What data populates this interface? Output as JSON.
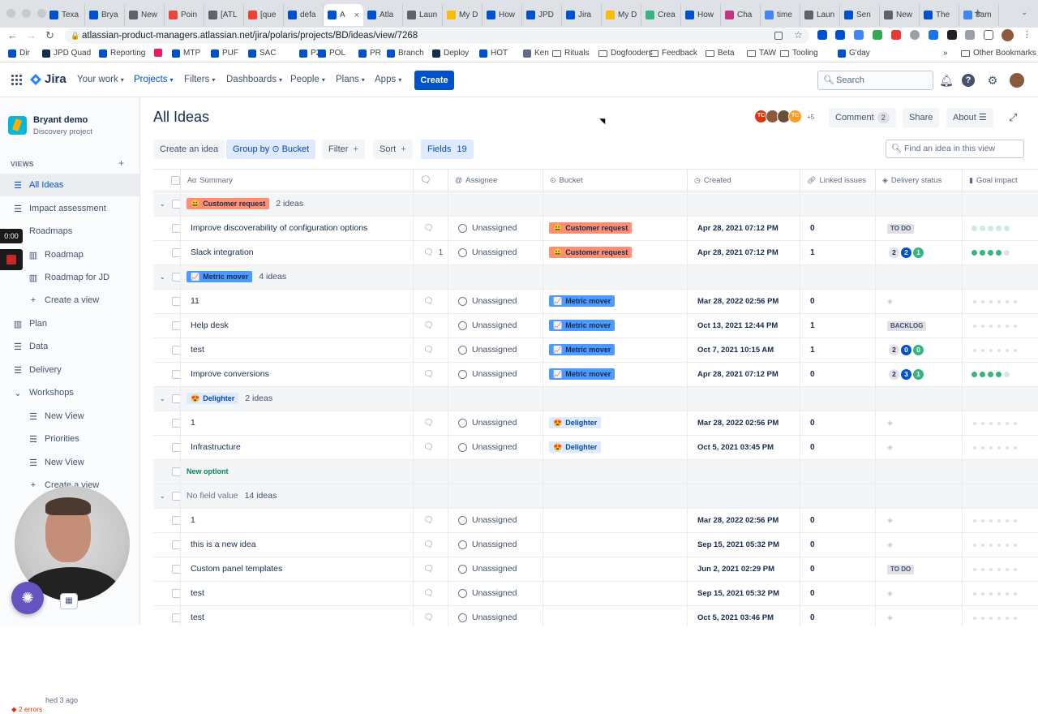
{
  "browser": {
    "tabs": [
      {
        "label": "Texa",
        "color": "#0052cc"
      },
      {
        "label": "Brya",
        "color": "#0052cc"
      },
      {
        "label": "New",
        "color": "#5f6368"
      },
      {
        "label": "Poin",
        "color": "#e8453c"
      },
      {
        "label": "[ATL",
        "color": "#5f6368"
      },
      {
        "label": "[que",
        "color": "#ea4335"
      },
      {
        "label": "defa",
        "color": "#0052cc"
      },
      {
        "label": "A",
        "color": "#0052cc",
        "active": true
      },
      {
        "label": "Atla",
        "color": "#0052cc"
      },
      {
        "label": "Laun",
        "color": "#5f6368"
      },
      {
        "label": "My D",
        "color": "#fbbc04"
      },
      {
        "label": "How",
        "color": "#0052cc"
      },
      {
        "label": "JPD",
        "color": "#0052cc"
      },
      {
        "label": "Jira",
        "color": "#0052cc"
      },
      {
        "label": "My D",
        "color": "#fbbc04"
      },
      {
        "label": "Crea",
        "color": "#36b37e"
      },
      {
        "label": "How",
        "color": "#0052cc"
      },
      {
        "label": "Cha",
        "color": "#c13584"
      },
      {
        "label": "time",
        "color": "#4285f4"
      },
      {
        "label": "Laun",
        "color": "#5f6368"
      },
      {
        "label": "Sen",
        "color": "#0052cc"
      },
      {
        "label": "New",
        "color": "#5f6368"
      },
      {
        "label": "The",
        "color": "#0052cc"
      },
      {
        "label": "8am",
        "color": "#4285f4"
      }
    ],
    "url": "atlassian-product-managers.atlassian.net/jira/polaris/projects/BD/ideas/view/7268",
    "bookmarks": [
      {
        "label": "Dir",
        "icon": "#0052cc"
      },
      {
        "label": "JPD Quad",
        "icon": "#172b4d"
      },
      {
        "label": "Reporting",
        "icon": "#0052cc"
      },
      {
        "label": "",
        "icon": "#e91e63"
      },
      {
        "label": "MTP",
        "icon": "#0052cc"
      },
      {
        "label": "PUF",
        "icon": "#0052cc"
      },
      {
        "label": "SAC",
        "icon": "#0052cc"
      },
      {
        "label": "P2",
        "icon": "#0052cc"
      },
      {
        "label": "POL",
        "icon": "#0052cc"
      },
      {
        "label": "PR",
        "icon": "#0052cc"
      },
      {
        "label": "Branch",
        "icon": "#0052cc"
      },
      {
        "label": "Deploy",
        "icon": "#172b4d"
      },
      {
        "label": "HOT",
        "icon": "#0052cc"
      },
      {
        "label": "Ken",
        "icon": "#5e6c84"
      },
      {
        "label": "Rituals",
        "icon": "folder"
      },
      {
        "label": "Dogfooders",
        "icon": "folder"
      },
      {
        "label": "Feedback",
        "icon": "folder"
      },
      {
        "label": "Beta",
        "icon": "folder"
      },
      {
        "label": "TAW",
        "icon": "folder"
      },
      {
        "label": "Tooling",
        "icon": "folder"
      },
      {
        "label": "G'day",
        "icon": "#0052cc"
      }
    ],
    "more": "»",
    "other_bookmarks": "Other Bookmarks"
  },
  "jira": {
    "logo": "Jira",
    "nav": [
      "Your work",
      "Projects",
      "Filters",
      "Dashboards",
      "People",
      "Plans",
      "Apps"
    ],
    "create": "Create",
    "search_placeholder": "Search"
  },
  "sidebar": {
    "project_name": "Bryant demo",
    "project_type": "Discovery project",
    "views_heading": "VIEWS",
    "items": [
      {
        "label": "All Ideas",
        "icon": "list",
        "selected": true
      },
      {
        "label": "Impact assessment",
        "icon": "list"
      },
      {
        "label": "Roadmaps",
        "icon": "chevron"
      },
      {
        "label": "Roadmap",
        "icon": "board",
        "indent": true
      },
      {
        "label": "Roadmap for JD",
        "icon": "board",
        "indent": true
      },
      {
        "label": "Create a view",
        "icon": "plus",
        "indent": true
      },
      {
        "label": "Plan",
        "icon": "board"
      },
      {
        "label": "Data",
        "icon": "list"
      },
      {
        "label": "Delivery",
        "icon": "list"
      },
      {
        "label": "Workshops",
        "icon": "chevron-down"
      },
      {
        "label": "New View",
        "icon": "list",
        "indent": true
      },
      {
        "label": "Priorities",
        "icon": "list",
        "indent": true
      },
      {
        "label": "New View",
        "icon": "list",
        "indent": true
      },
      {
        "label": "Create a view",
        "icon": "plus",
        "indent": true
      }
    ],
    "updated": "hed 3 ago",
    "errors": "2 errors"
  },
  "recording": {
    "timer": "0:00"
  },
  "header": {
    "title": "All Ideas",
    "avatars": [
      {
        "initials": "TC",
        "color": "#de350b"
      },
      {
        "initials": "",
        "color": "#8b5a3c"
      },
      {
        "initials": "",
        "color": "#6b4f3a"
      },
      {
        "initials": "TC",
        "color": "#ff991f"
      }
    ],
    "extra_avatars": "+5",
    "comment": "Comment",
    "comment_count": "2",
    "share": "Share",
    "about": "About"
  },
  "toolbar": {
    "create_idea": "Create an idea",
    "group_by": "Group by",
    "group_by_value": "Bucket",
    "filter": "Filter",
    "sort": "Sort",
    "fields": "Fields",
    "fields_count": "19",
    "find_placeholder": "Find an idea in this view"
  },
  "table": {
    "columns": [
      "Summary",
      "",
      "Assignee",
      "Bucket",
      "Created",
      "Linked issues",
      "Delivery status",
      "Goal impact"
    ],
    "rows": [
      {
        "type": "group",
        "tag": "Customer request",
        "tagClass": "tag-cr",
        "emoji": "😃",
        "count": "2 ideas"
      },
      {
        "type": "idea",
        "summary": "Improve discoverability of configuration options",
        "comments": "",
        "assignee": "Unassigned",
        "bucket": "Customer request",
        "bucketClass": "tag-cr",
        "emoji": "😃",
        "created": "Apr 28, 2021 07:12 PM",
        "linked": "0",
        "status": {
          "kind": "label",
          "text": "TO DO"
        },
        "goal": {
          "kind": "partial",
          "filled": 0
        }
      },
      {
        "type": "idea",
        "summary": "Slack integration",
        "comments": "1",
        "assignee": "Unassigned",
        "bucket": "Customer request",
        "bucketClass": "tag-cr",
        "emoji": "😃",
        "created": "Apr 28, 2021 07:12 PM",
        "linked": "1",
        "status": {
          "kind": "pills",
          "values": [
            "2",
            "2",
            "1"
          ]
        },
        "goal": {
          "kind": "full",
          "filled": 4
        }
      },
      {
        "type": "group",
        "tag": "Metric mover",
        "tagClass": "tag-mm",
        "emoji": "📈",
        "count": "4 ideas"
      },
      {
        "type": "idea",
        "summary": "11",
        "comments": "",
        "assignee": "Unassigned",
        "bucket": "Metric mover",
        "bucketClass": "tag-mm",
        "emoji": "📈",
        "created": "Mar 28, 2022 02:56 PM",
        "linked": "0",
        "status": {
          "kind": "empty"
        },
        "goal": {
          "kind": "empty"
        }
      },
      {
        "type": "idea",
        "summary": "Help desk",
        "comments": "",
        "assignee": "Unassigned",
        "bucket": "Metric mover",
        "bucketClass": "tag-mm",
        "emoji": "📈",
        "created": "Oct 13, 2021 12:44 PM",
        "linked": "1",
        "status": {
          "kind": "label",
          "text": "BACKLOG"
        },
        "goal": {
          "kind": "empty"
        }
      },
      {
        "type": "idea",
        "summary": "test",
        "comments": "",
        "assignee": "Unassigned",
        "bucket": "Metric mover",
        "bucketClass": "tag-mm",
        "emoji": "📈",
        "created": "Oct 7, 2021 10:15 AM",
        "linked": "1",
        "status": {
          "kind": "pills",
          "values": [
            "2",
            "0",
            "0"
          ]
        },
        "goal": {
          "kind": "empty"
        }
      },
      {
        "type": "idea",
        "summary": "Improve conversions",
        "comments": "",
        "assignee": "Unassigned",
        "bucket": "Metric mover",
        "bucketClass": "tag-mm",
        "emoji": "📈",
        "created": "Apr 28, 2021 07:12 PM",
        "linked": "0",
        "status": {
          "kind": "pills",
          "values": [
            "2",
            "3",
            "1"
          ]
        },
        "goal": {
          "kind": "full",
          "filled": 4
        }
      },
      {
        "type": "group",
        "tag": "Delighter",
        "tagClass": "tag-de",
        "emoji": "😍",
        "count": "2 ideas"
      },
      {
        "type": "idea",
        "summary": "1",
        "comments": "",
        "assignee": "Unassigned",
        "bucket": "Delighter",
        "bucketClass": "tag-de",
        "emoji": "😍",
        "created": "Mar 28, 2022 02:56 PM",
        "linked": "0",
        "status": {
          "kind": "empty"
        },
        "goal": {
          "kind": "empty"
        }
      },
      {
        "type": "idea",
        "summary": "Infrastructure",
        "comments": "",
        "assignee": "Unassigned",
        "bucket": "Delighter",
        "bucketClass": "tag-de",
        "emoji": "😍",
        "created": "Oct 5, 2021 03:45 PM",
        "linked": "0",
        "status": {
          "kind": "empty"
        },
        "goal": {
          "kind": "empty"
        }
      },
      {
        "type": "group",
        "tag": "New optiont",
        "tagClass": "tag-no",
        "emoji": "",
        "count": "",
        "nochev": true
      },
      {
        "type": "group",
        "tag": "No field value",
        "tagClass": "nfv",
        "emoji": "",
        "count": "14 ideas"
      },
      {
        "type": "idea",
        "summary": "1",
        "comments": "",
        "assignee": "Unassigned",
        "bucket": "",
        "created": "Mar 28, 2022 02:56 PM",
        "linked": "0",
        "status": {
          "kind": "empty"
        },
        "goal": {
          "kind": "empty"
        }
      },
      {
        "type": "idea",
        "summary": "this is a new idea",
        "comments": "",
        "assignee": "Unassigned",
        "bucket": "",
        "created": "Sep 15, 2021 05:32 PM",
        "linked": "0",
        "status": {
          "kind": "empty"
        },
        "goal": {
          "kind": "empty"
        }
      },
      {
        "type": "idea",
        "summary": "Custom panel templates",
        "comments": "",
        "assignee": "Unassigned",
        "bucket": "",
        "created": "Jun 2, 2021 02:29 PM",
        "linked": "0",
        "status": {
          "kind": "label",
          "text": "TO DO"
        },
        "goal": {
          "kind": "empty"
        }
      },
      {
        "type": "idea",
        "summary": "test",
        "comments": "",
        "assignee": "Unassigned",
        "bucket": "",
        "created": "Sep 15, 2021 05:32 PM",
        "linked": "0",
        "status": {
          "kind": "empty"
        },
        "goal": {
          "kind": "empty"
        }
      },
      {
        "type": "idea",
        "summary": "test",
        "comments": "",
        "assignee": "Unassigned",
        "bucket": "",
        "created": "Oct 5, 2021 03:46 PM",
        "linked": "0",
        "status": {
          "kind": "empty"
        },
        "goal": {
          "kind": "empty"
        }
      }
    ]
  },
  "colors": {
    "primary": "#0052cc",
    "pill_blue": "#0052cc",
    "pill_green": "#36b37e",
    "goal_green": "#36b37e"
  }
}
